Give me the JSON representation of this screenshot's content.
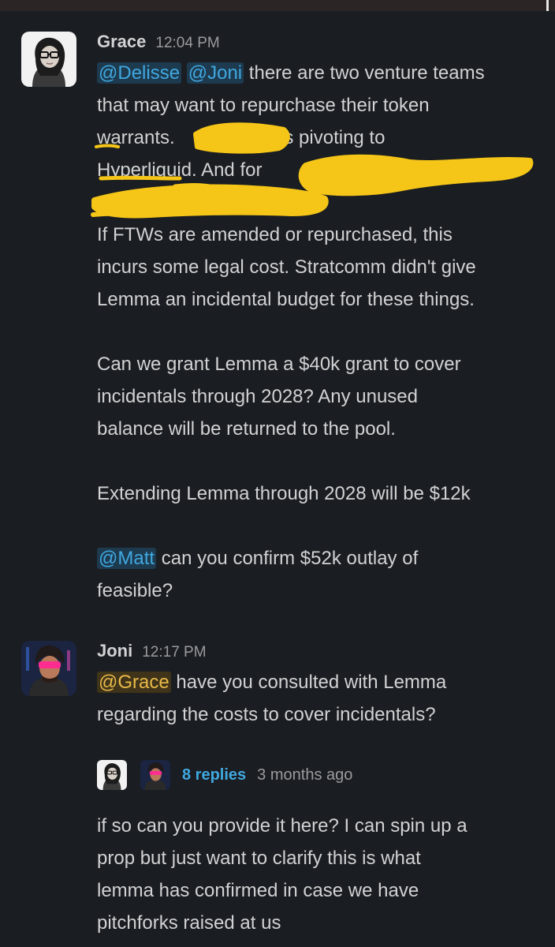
{
  "messages": [
    {
      "author": "Grace",
      "time": "12:04 PM",
      "lines": [
        {
          "m1": "@Delisse",
          "m2": "@Joni",
          "t": "there are two venture teams"
        },
        {
          "t": "that may want to repurchase their token"
        },
        {
          "t1": "warrants. ",
          "t2": " is pivoting to"
        },
        {
          "t1": "Hyperliquid. And for "
        },
        {
          "t": ""
        },
        {
          "t": "If FTWs are amended or repurchased, this"
        },
        {
          "t": "incurs some legal cost. Stratcomm didn't give"
        },
        {
          "t": "Lemma an incidental budget for these things."
        },
        {
          "t": "Can we grant Lemma a $40k grant to cover"
        },
        {
          "t": "incidentals through 2028? Any unused"
        },
        {
          "t": "balance will be returned to the pool."
        },
        {
          "t": "Extending Lemma through 2028 will be $12k"
        },
        {
          "m": "@Matt",
          "t": "can you confirm $52k outlay of"
        },
        {
          "t": "feasible?"
        }
      ]
    },
    {
      "author": "Joni",
      "time": "12:17 PM",
      "lines": [
        {
          "m": "@Grace",
          "t": "have you consulted with Lemma"
        },
        {
          "t": "regarding the costs to cover incidentals?"
        }
      ],
      "thread": {
        "replies": "8 replies",
        "last": "3 months ago"
      }
    },
    {
      "lines": [
        {
          "t": "if so can you provide it here? I can spin up a"
        },
        {
          "t": "prop but just want to clarify this is what"
        },
        {
          "t": "lemma has confirmed in case we have"
        },
        {
          "t": "pitchforks raised at us"
        }
      ]
    }
  ],
  "colors": {
    "background": "#1a1d21",
    "mention": "#40a8e0",
    "self_mention": "#e9b949",
    "redaction": "#f5c518"
  }
}
